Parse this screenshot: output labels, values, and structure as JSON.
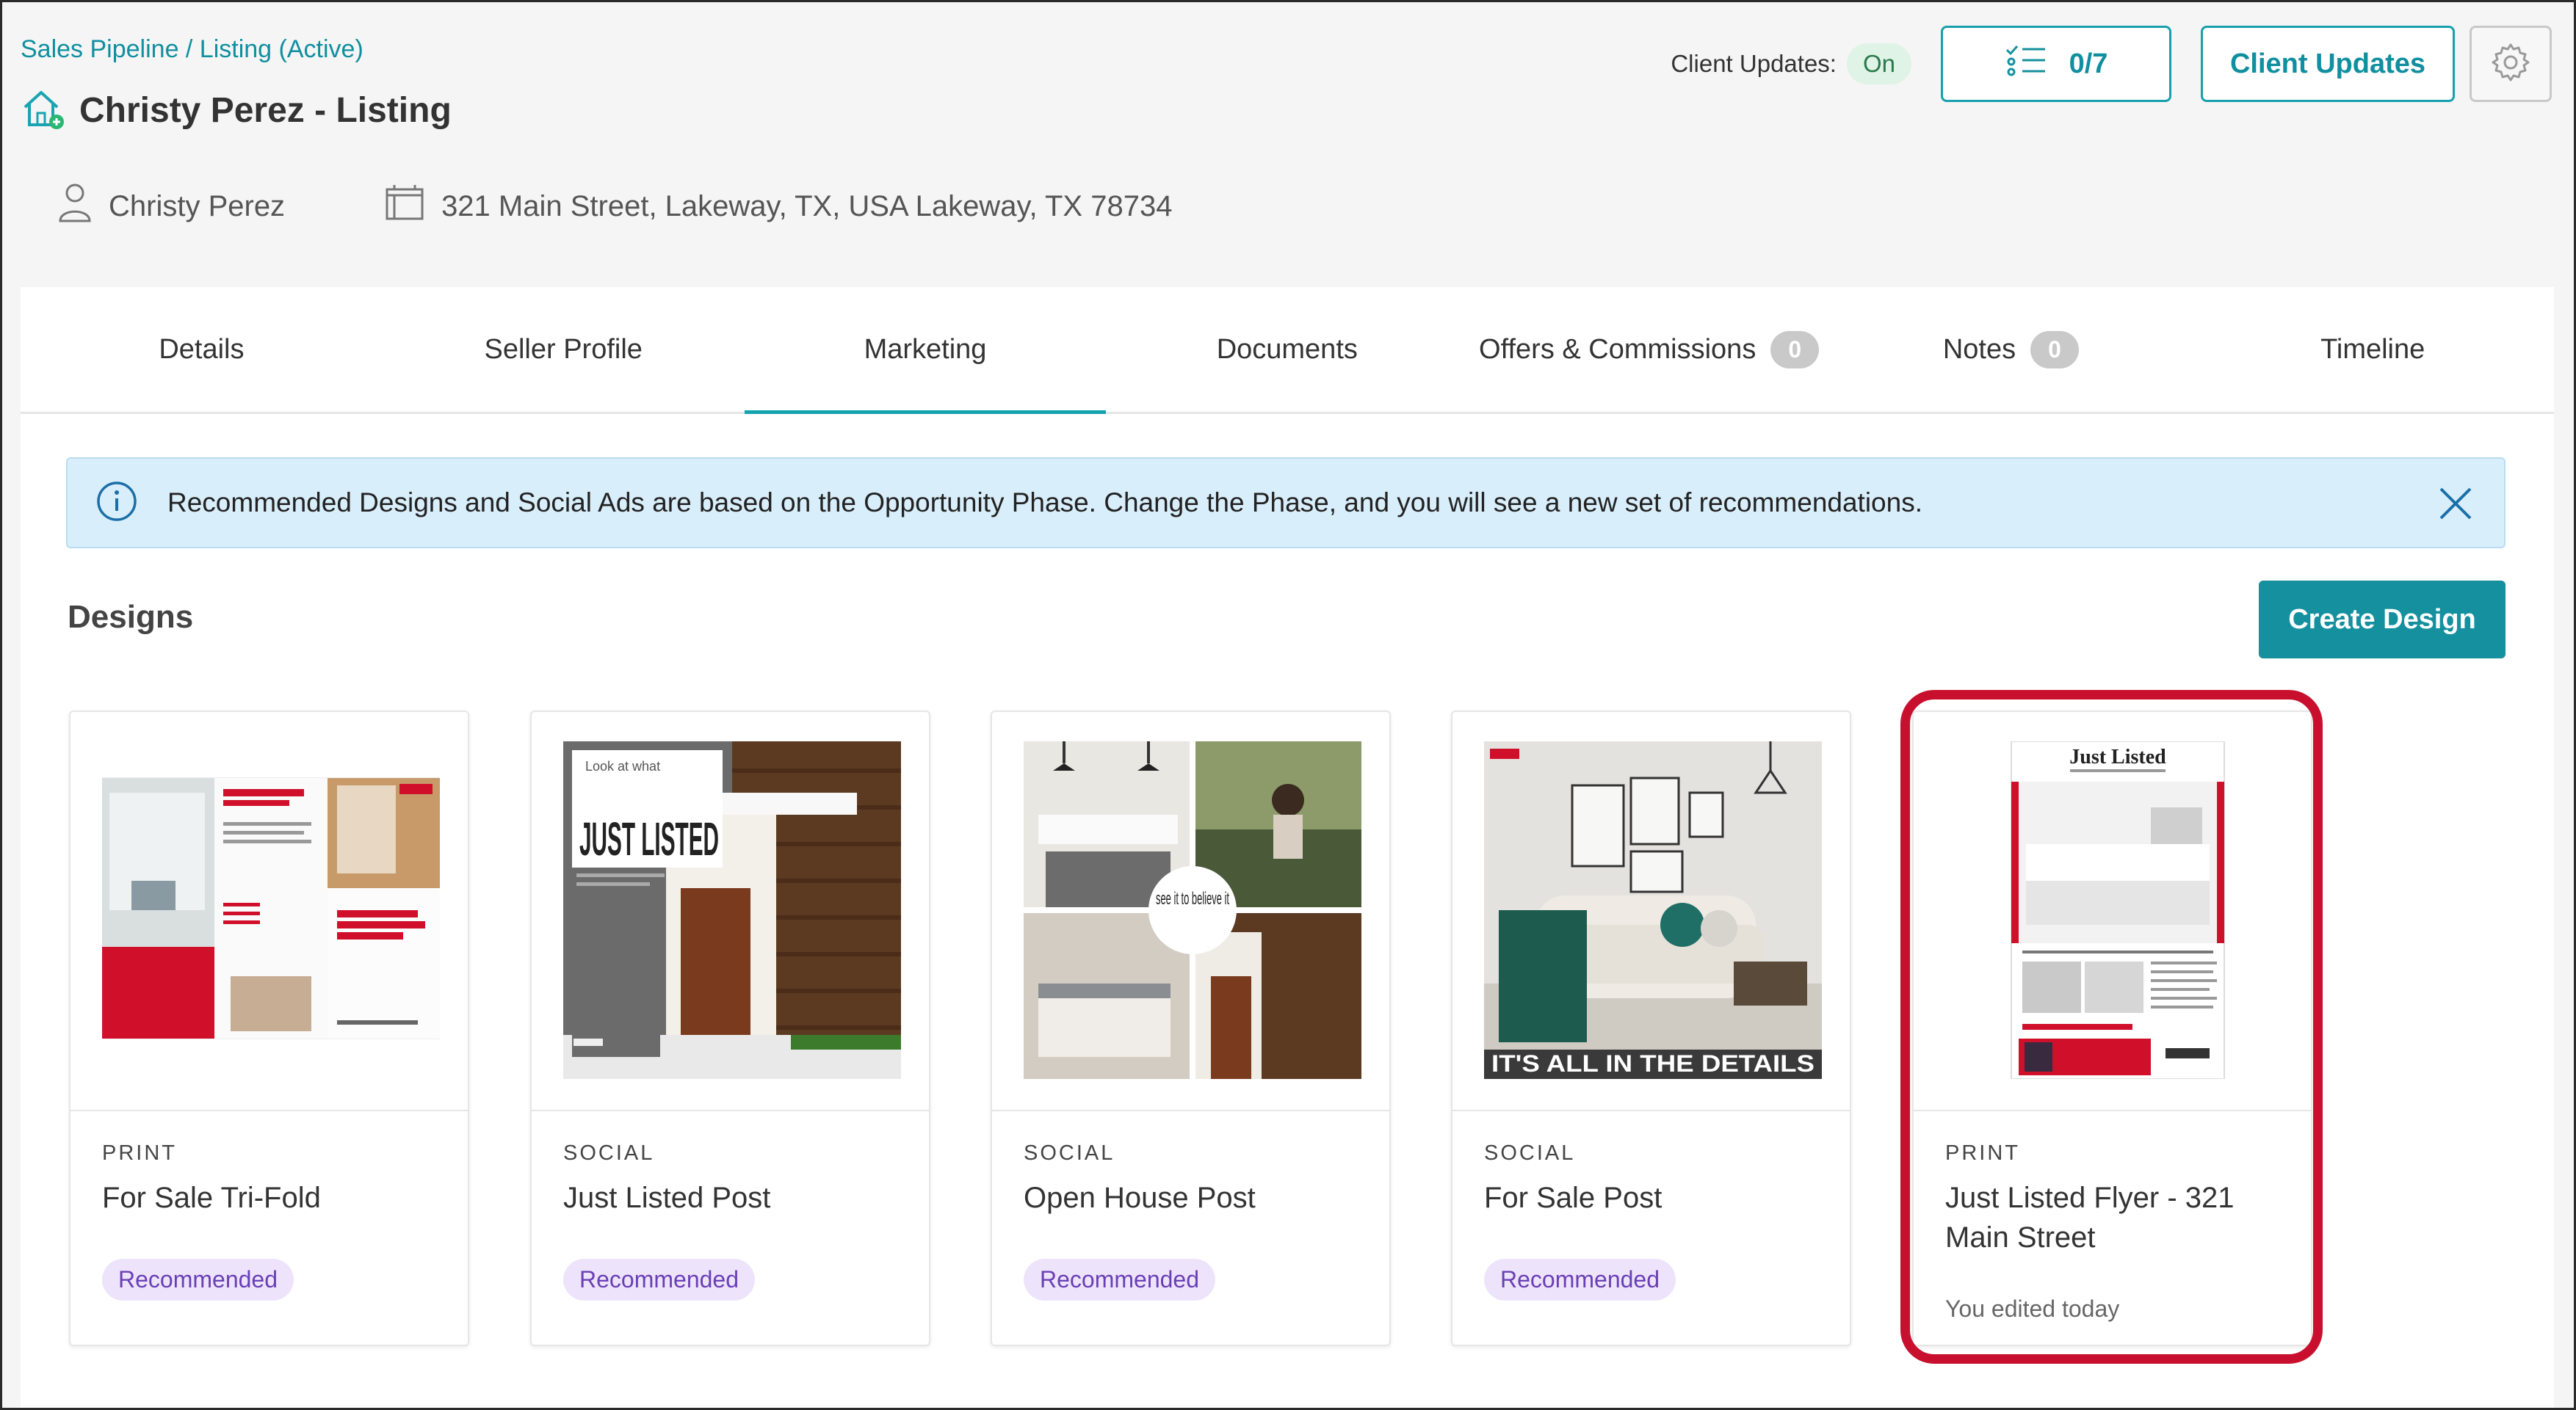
{
  "header": {
    "breadcrumb": "Sales Pipeline / Listing (Active)",
    "title": "Christy Perez - Listing",
    "client_name": "Christy Perez",
    "address": "321 Main Street, Lakeway, TX, USA Lakeway, TX 78734",
    "client_updates_label": "Client Updates:",
    "client_updates_state": "On",
    "tasks_progress": "0/7",
    "client_updates_button": "Client Updates"
  },
  "tabs": [
    {
      "label": "Details"
    },
    {
      "label": "Seller Profile"
    },
    {
      "label": "Marketing",
      "active": true
    },
    {
      "label": "Documents"
    },
    {
      "label": "Offers & Commissions",
      "count": "0"
    },
    {
      "label": "Notes",
      "count": "0"
    },
    {
      "label": "Timeline"
    }
  ],
  "banner": {
    "text": "Recommended Designs and Social Ads are based on the Opportunity Phase. Change the Phase, and you will see a new set of recommendations."
  },
  "designs": {
    "heading": "Designs",
    "create_button": "Create Design",
    "cards": [
      {
        "kind": "PRINT",
        "name": "For Sale Tri-Fold",
        "badge": "Recommended"
      },
      {
        "kind": "SOCIAL",
        "name": "Just Listed Post",
        "badge": "Recommended",
        "thumb_text": "JUST LISTED",
        "thumb_small": "Look at what"
      },
      {
        "kind": "SOCIAL",
        "name": "Open House Post",
        "badge": "Recommended",
        "thumb_text": "see it to believe it"
      },
      {
        "kind": "SOCIAL",
        "name": "For Sale Post",
        "badge": "Recommended",
        "thumb_text": "IT'S ALL IN THE DETAILS"
      },
      {
        "kind": "PRINT",
        "name": "Just Listed Flyer - 321 Main Street",
        "edited": "You edited today",
        "thumb_text": "Just Listed"
      }
    ]
  },
  "colors": {
    "accent": "#14909e",
    "highlight": "#c8102e",
    "badge_bg": "#ede4fb",
    "badge_text": "#6a3fb5"
  }
}
